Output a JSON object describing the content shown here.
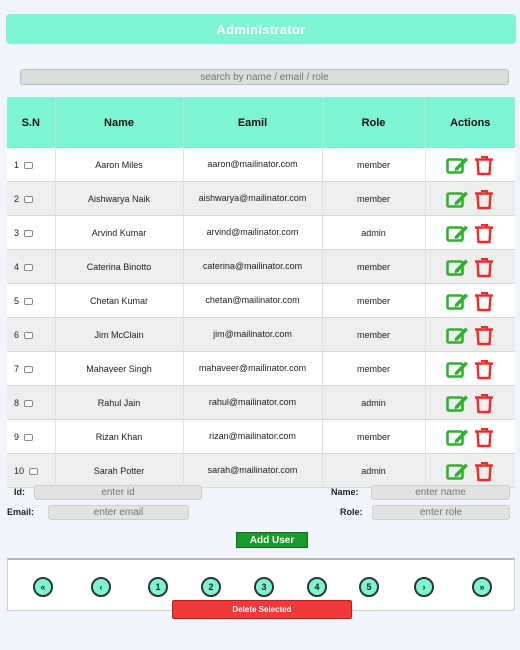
{
  "header": {
    "title": "Administrator"
  },
  "search": {
    "placeholder": "search by name / email / role"
  },
  "table": {
    "columns": [
      "S.N",
      "Name",
      "Eamil",
      "Role",
      "Actions"
    ],
    "rows": [
      {
        "sn": "1",
        "name": "Aaron Miles",
        "email": "aaron@mailinator.com",
        "role": "member"
      },
      {
        "sn": "2",
        "name": "Aishwarya Naik",
        "email": "aishwarya@mailinator.com",
        "role": "member"
      },
      {
        "sn": "3",
        "name": "Arvind Kumar",
        "email": "arvind@mailinator.com",
        "role": "admin"
      },
      {
        "sn": "4",
        "name": "Caterina Binotto",
        "email": "caterina@mailinator.com",
        "role": "member"
      },
      {
        "sn": "5",
        "name": "Chetan Kumar",
        "email": "chetan@mailinator.com",
        "role": "member"
      },
      {
        "sn": "6",
        "name": "Jim McClain",
        "email": "jim@mailinator.com",
        "role": "member"
      },
      {
        "sn": "7",
        "name": "Mahaveer Singh",
        "email": "mahaveer@mailinator.com",
        "role": "member"
      },
      {
        "sn": "8",
        "name": "Rahul Jain",
        "email": "rahul@mailinator.com",
        "role": "admin"
      },
      {
        "sn": "9",
        "name": "Rizan Khan",
        "email": "rizan@mailinator.com",
        "role": "member"
      },
      {
        "sn": "10",
        "name": "Sarah Potter",
        "email": "sarah@mailinator.com",
        "role": "admin"
      }
    ],
    "edit_icon": "edit-icon",
    "delete_icon": "trash-icon"
  },
  "form": {
    "id_label": "Id:",
    "id_placeholder": "enter id",
    "name_label": "Name:",
    "name_placeholder": "enter name",
    "email_label": "Email:",
    "email_placeholder": "enter email",
    "role_label": "Role:",
    "role_placeholder": "enter role",
    "add_label": "Add User"
  },
  "pagination": {
    "first": "«",
    "prev": "‹",
    "pages": [
      "1",
      "2",
      "3",
      "4",
      "5"
    ],
    "next": "›",
    "last": "»"
  },
  "delete_selected_label": "Delete Selected",
  "colors": {
    "accent": "#7df5d2",
    "edit": "#2fb12f",
    "delete": "#ee2b2b",
    "add": "#1a9a2a",
    "danger": "#f03a3a"
  }
}
